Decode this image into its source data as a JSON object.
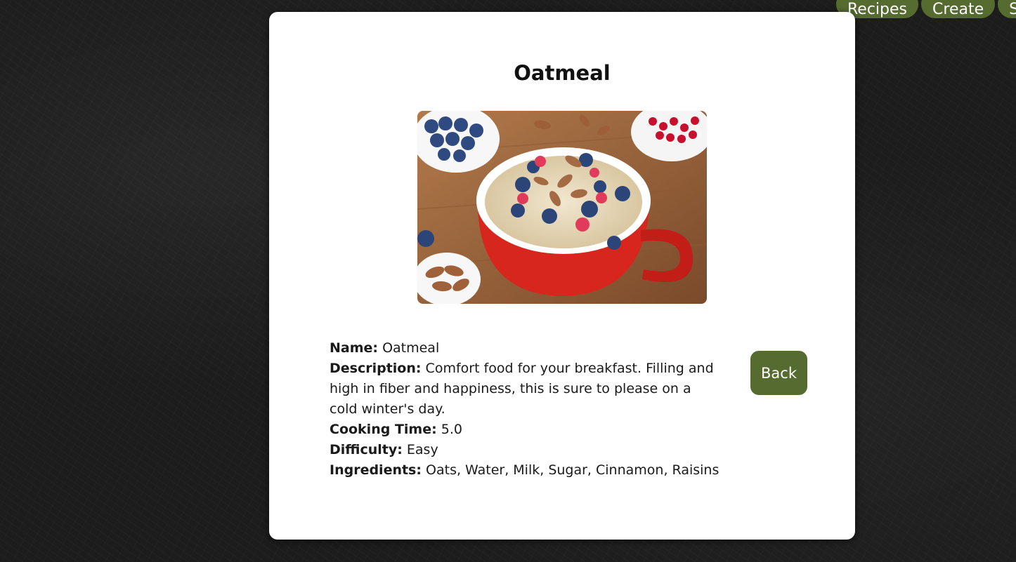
{
  "nav": {
    "items": [
      {
        "label": "Recipes"
      },
      {
        "label": "Create"
      },
      {
        "label": "Se"
      }
    ]
  },
  "recipe": {
    "title": "Oatmeal",
    "image_alt": "Bowl of oatmeal topped with blueberries, raspberries and almonds",
    "fields": {
      "name_label": "Name:",
      "name_value": "Oatmeal",
      "description_label": "Description:",
      "description_value": "Comfort food for your breakfast. Filling and high in fiber and happiness, this is sure to please on a cold winter's day.",
      "cooking_time_label": "Cooking Time:",
      "cooking_time_value": "5.0",
      "difficulty_label": "Difficulty:",
      "difficulty_value": "Easy",
      "ingredients_label": "Ingredients:",
      "ingredients_value": "Oats, Water, Milk, Sugar, Cinnamon, Raisins"
    }
  },
  "actions": {
    "back_label": "Back"
  },
  "colors": {
    "accent": "#556b2f",
    "card": "#ffffff",
    "background": "#1c1c1c"
  }
}
